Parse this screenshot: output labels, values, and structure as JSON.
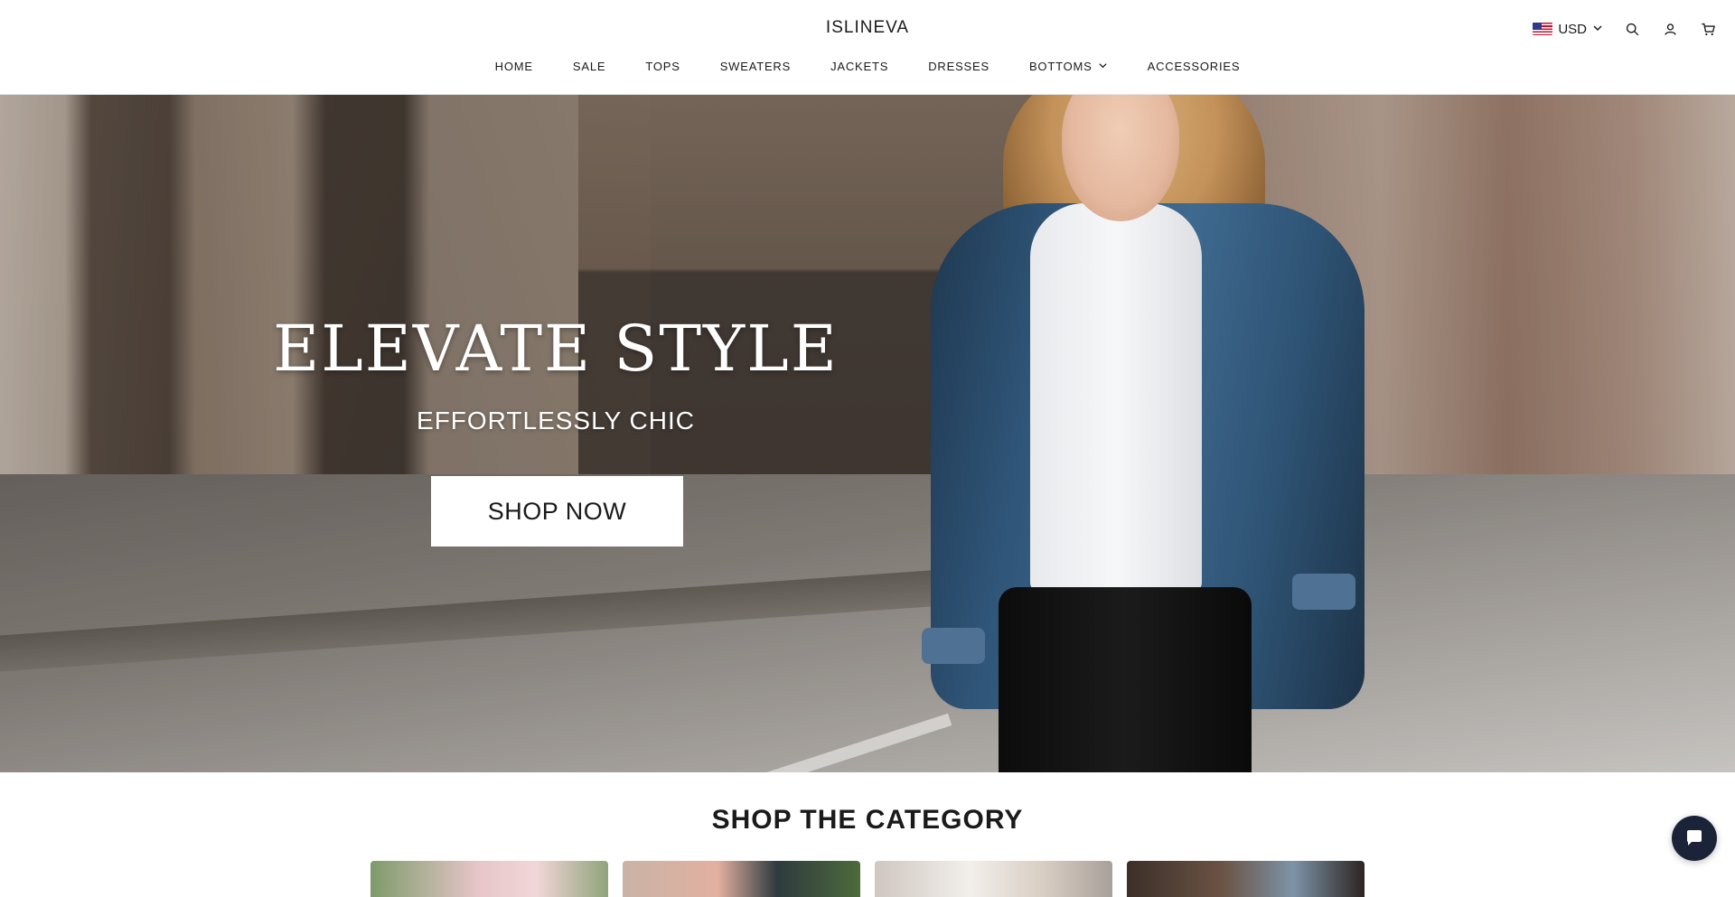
{
  "header": {
    "brand": "ISLINEVA",
    "currency": "USD"
  },
  "nav": [
    {
      "label": "HOME"
    },
    {
      "label": "SALE"
    },
    {
      "label": "TOPS"
    },
    {
      "label": "SWEATERS"
    },
    {
      "label": "JACKETS"
    },
    {
      "label": "DRESSES"
    },
    {
      "label": "BOTTOMS"
    },
    {
      "label": "ACCESSORIES"
    }
  ],
  "hero": {
    "title": "ELEVATE STYLE",
    "subtitle": "EFFORTLESSLY CHIC",
    "cta": "SHOP NOW"
  },
  "category_section": {
    "title": "SHOP THE CATEGORY"
  },
  "icons": {
    "flag": "us-flag-icon",
    "currency_chevron": "chevron-down-icon",
    "search": "search-icon",
    "account": "user-icon",
    "cart": "cart-icon",
    "nav_dropdown": "chevron-down-icon",
    "chat": "chat-icon"
  },
  "colors": {
    "text": "#1a1a1a",
    "background": "#ffffff",
    "chat_button": "#1b2338"
  }
}
